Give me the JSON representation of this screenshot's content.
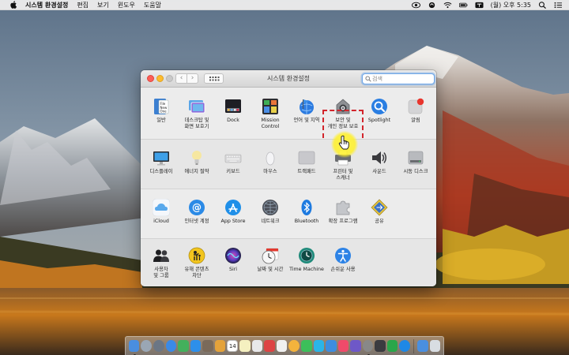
{
  "menubar": {
    "app_name": "시스템 환경설정",
    "items": [
      "편집",
      "보기",
      "윈도우",
      "도움말"
    ],
    "clock": "(월) 오후 5:35"
  },
  "window": {
    "title": "시스템 환경설정",
    "search_placeholder": "검색"
  },
  "panes": {
    "row1": [
      {
        "label": "일반",
        "icon": "file-new-icon"
      },
      {
        "label": "데스크탑 및\n화면 보호기",
        "icon": "desktop-icon"
      },
      {
        "label": "Dock",
        "icon": "dock-icon"
      },
      {
        "label": "Mission\nControl",
        "icon": "mission-control-icon"
      },
      {
        "label": "언어 및 지역",
        "icon": "flag-globe-icon"
      },
      {
        "label": "보안 및\n개인 정보 보호",
        "icon": "security-house-icon"
      },
      {
        "label": "Spotlight",
        "icon": "magnifier-icon"
      },
      {
        "label": "알림",
        "icon": "notifications-icon"
      }
    ],
    "row2": [
      {
        "label": "디스플레이",
        "icon": "display-icon"
      },
      {
        "label": "에너지 절약",
        "icon": "lightbulb-icon"
      },
      {
        "label": "키보드",
        "icon": "keyboard-icon"
      },
      {
        "label": "마우스",
        "icon": "mouse-icon"
      },
      {
        "label": "트랙패드",
        "icon": "trackpad-icon"
      },
      {
        "label": "프린터 및\n스캐너",
        "icon": "printer-icon"
      },
      {
        "label": "사운드",
        "icon": "speaker-icon"
      },
      {
        "label": "시동 디스크",
        "icon": "startup-disk-icon"
      }
    ],
    "row3": [
      {
        "label": "iCloud",
        "icon": "icloud-icon"
      },
      {
        "label": "인터넷 계정",
        "icon": "at-sign-icon"
      },
      {
        "label": "App Store",
        "icon": "app-store-icon"
      },
      {
        "label": "네트워크",
        "icon": "network-globe-icon"
      },
      {
        "label": "Bluetooth",
        "icon": "bluetooth-icon"
      },
      {
        "label": "확장 프로그램",
        "icon": "puzzle-icon"
      },
      {
        "label": "공유",
        "icon": "sharing-icon"
      }
    ],
    "row4": [
      {
        "label": "사용자\n및 그룹",
        "icon": "users-icon"
      },
      {
        "label": "유해 콘텐츠\n차단",
        "icon": "parental-controls-icon"
      },
      {
        "label": "Siri",
        "icon": "siri-icon"
      },
      {
        "label": "날짜 및 시간",
        "icon": "clock-calendar-icon"
      },
      {
        "label": "Time Machine",
        "icon": "time-machine-icon"
      },
      {
        "label": "손쉬운 사용",
        "icon": "accessibility-icon"
      }
    ]
  },
  "dock": {
    "calendar_day": "14"
  },
  "colors": {
    "highlight_border": "#d2252c",
    "cursor_glow": "#fff23c",
    "search_focus": "#6ea7e8"
  }
}
